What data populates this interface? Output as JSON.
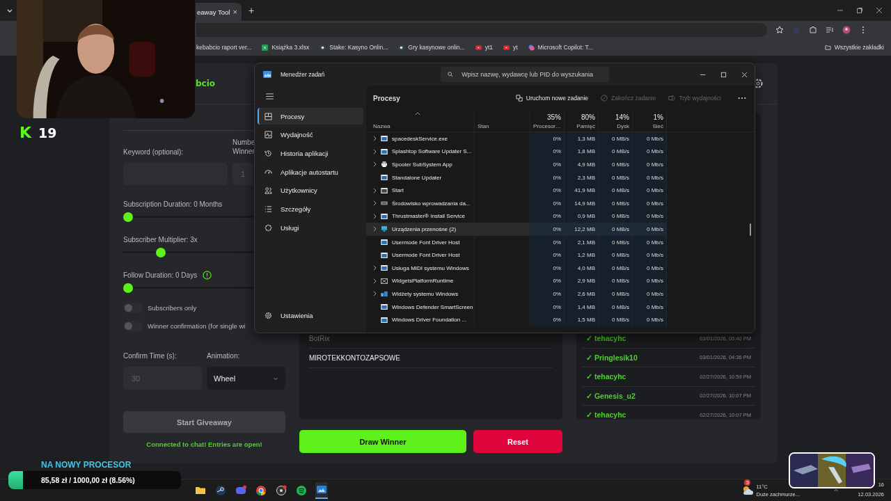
{
  "browser": {
    "tab_title": "eaway Tool",
    "tab_close": "×",
    "new_tab": "+",
    "bookmarks": [
      {
        "label": "kebabcio raport ver...",
        "kind": "none"
      },
      {
        "label": "Książka 3.xlsx",
        "kind": "sheet"
      },
      {
        "label": "Stake: Kasyno Onlin...",
        "kind": "stake"
      },
      {
        "label": "Gry kasynowe onlin...",
        "kind": "stake"
      },
      {
        "label": "yt1",
        "kind": "video"
      },
      {
        "label": "yt",
        "kind": "video"
      },
      {
        "label": "Microsoft Copilot: T...",
        "kind": "copilot"
      }
    ],
    "all_bookmarks": "Wszystkie zakładki"
  },
  "giveaway": {
    "brand": "bcio",
    "keyword_label": "Keyword (optional):",
    "winners_label": "Numbe Winner",
    "winners_placeholder": "1",
    "sliders": [
      {
        "label": "Subscription Duration: 0 Months",
        "level": 0,
        "info": false
      },
      {
        "label": "Subscriber Multiplier: 3x",
        "level": 0.27,
        "info": false
      },
      {
        "label": "Follow Duration:  0  Days",
        "level": 0,
        "info": true
      }
    ],
    "toggles": [
      {
        "label": "Subscribers only",
        "on": false
      },
      {
        "label": "Winner confirmation (for single wi",
        "on": false
      }
    ],
    "confirm_label": "Confirm Time (s):",
    "confirm_placeholder": "30",
    "animation_label": "Animation:",
    "animation_value": "Wheel",
    "start_button": "Start Giveaway",
    "status": "Connected to chat! Entries are open!",
    "entries": [
      {
        "name": "BotRix",
        "muted": true
      },
      {
        "name": "MIROTEKKONTOZAPSOWE",
        "muted": false
      }
    ],
    "winners": [
      {
        "name": "✓ tehacyhc",
        "time": "03/01/2026, 05:40 PM"
      },
      {
        "name": "✓ Pringlesik10",
        "time": "03/01/2026, 04:36 PM"
      },
      {
        "name": "✓ tehacyhc",
        "time": "02/27/2026, 10:59 PM"
      },
      {
        "name": "✓ Genesis_u2",
        "time": "02/27/2026, 10:07 PM"
      },
      {
        "name": "✓ tehacyhc",
        "time": "02/27/2026, 10:07 PM"
      }
    ],
    "draw_button": "Draw Winner",
    "reset_button": "Reset"
  },
  "task_manager": {
    "title": "Menedżer zadań",
    "search_placeholder": "Wpisz nazwę, wydawcę lub PID do wyszukania",
    "nav": [
      {
        "label": "Procesy",
        "kind": "processes",
        "selected": true
      },
      {
        "label": "Wydajność",
        "kind": "performance",
        "selected": false
      },
      {
        "label": "Historia aplikacji",
        "kind": "history",
        "selected": false
      },
      {
        "label": "Aplikacje autostartu",
        "kind": "startup",
        "selected": false
      },
      {
        "label": "Użytkownicy",
        "kind": "users",
        "selected": false
      },
      {
        "label": "Szczegóły",
        "kind": "details",
        "selected": false
      },
      {
        "label": "Usługi",
        "kind": "services",
        "selected": false
      }
    ],
    "settings": "Ustawienia",
    "page_title": "Procesy",
    "actions": [
      {
        "label": "Uruchom nowe zadanie",
        "kind": "run",
        "disabled": false
      },
      {
        "label": "Zakończ zadanie",
        "kind": "end",
        "disabled": true
      },
      {
        "label": "Tryb wydajności",
        "kind": "eco",
        "disabled": true
      }
    ],
    "columns": [
      {
        "kind": "name",
        "label": "Nazwa"
      },
      {
        "kind": "status",
        "label": "Stan"
      },
      {
        "kind": "metric",
        "usage": "35%",
        "label": "Procesor…"
      },
      {
        "kind": "metric",
        "usage": "80%",
        "label": "Pamięć"
      },
      {
        "kind": "metric",
        "usage": "14%",
        "label": "Dysk"
      },
      {
        "kind": "metric",
        "usage": "1%",
        "label": "Sieć"
      }
    ],
    "rows": [
      {
        "name": "spacedeskService.exe",
        "kind": "app",
        "expandable": true,
        "highlighted": false,
        "cpu": "0%",
        "mem": "1,3 MB",
        "disk": "0 MB/s",
        "net": "0 Mb/s"
      },
      {
        "name": "Splashtop Software Updater S...",
        "kind": "app",
        "expandable": true,
        "highlighted": false,
        "cpu": "0%",
        "mem": "1,8 MB",
        "disk": "0 MB/s",
        "net": "0 Mb/s"
      },
      {
        "name": "Spooler SubSystem App",
        "kind": "printer",
        "expandable": true,
        "highlighted": false,
        "cpu": "0%",
        "mem": "4,9 MB",
        "disk": "0 MB/s",
        "net": "0 Mb/s"
      },
      {
        "name": "Standalone Updater",
        "kind": "app",
        "expandable": false,
        "highlighted": false,
        "cpu": "0%",
        "mem": "2,3 MB",
        "disk": "0 MB/s",
        "net": "0 Mb/s"
      },
      {
        "name": "Start",
        "kind": "window",
        "expandable": true,
        "highlighted": false,
        "cpu": "0%",
        "mem": "41,9 MB",
        "disk": "0 MB/s",
        "net": "0 Mb/s"
      },
      {
        "name": "Środowisko wprowadzania da...",
        "kind": "keyboard",
        "expandable": true,
        "highlighted": false,
        "cpu": "0%",
        "mem": "14,9 MB",
        "disk": "0 MB/s",
        "net": "0 Mb/s"
      },
      {
        "name": "Thrustmaster® Install Service",
        "kind": "app",
        "expandable": true,
        "highlighted": false,
        "cpu": "0%",
        "mem": "0,9 MB",
        "disk": "0 MB/s",
        "net": "0 Mb/s"
      },
      {
        "name": "Urządzenia przenośne (2)",
        "kind": "device",
        "expandable": true,
        "highlighted": true,
        "cpu": "0%",
        "mem": "12,2 MB",
        "disk": "0 MB/s",
        "net": "0 Mb/s"
      },
      {
        "name": "Usermode Font Driver Host",
        "kind": "app",
        "expandable": false,
        "highlighted": false,
        "cpu": "0%",
        "mem": "2,1 MB",
        "disk": "0 MB/s",
        "net": "0 Mb/s"
      },
      {
        "name": "Usermode Font Driver Host",
        "kind": "app",
        "expandable": false,
        "highlighted": false,
        "cpu": "0%",
        "mem": "1,2 MB",
        "disk": "0 MB/s",
        "net": "0 Mb/s"
      },
      {
        "name": "Usługa MIDI systemu Windows",
        "kind": "app",
        "expandable": true,
        "highlighted": false,
        "cpu": "0%",
        "mem": "4,0 MB",
        "disk": "0 MB/s",
        "net": "0 Mb/s"
      },
      {
        "name": "WidgetsPlatformRuntime",
        "kind": "crossed",
        "expandable": true,
        "highlighted": false,
        "cpu": "0%",
        "mem": "2,9 MB",
        "disk": "0 MB/s",
        "net": "0 Mb/s"
      },
      {
        "name": "Widżety systemu Windows",
        "kind": "widgets",
        "expandable": true,
        "highlighted": false,
        "cpu": "0%",
        "mem": "2,6 MB",
        "disk": "0 MB/s",
        "net": "0 Mb/s"
      },
      {
        "name": "Windows Defender SmartScreen",
        "kind": "app",
        "expandable": false,
        "highlighted": false,
        "cpu": "0%",
        "mem": "1,4 MB",
        "disk": "0 MB/s",
        "net": "0 Mb/s"
      },
      {
        "name": "Windows Driver Foundation ...",
        "kind": "app",
        "expandable": false,
        "highlighted": false,
        "cpu": "0%",
        "mem": "1,5 MB",
        "disk": "0 MB/s",
        "net": "0 Mb/s"
      }
    ]
  },
  "stream": {
    "logo": "K",
    "viewers": "19",
    "goal_title": "NA NOWY PROCESOR",
    "goal_text": "85,58 zł / 1000,00 zł (8.56%)",
    "level": 0.0856
  },
  "taskbar": {
    "apps": [
      {
        "kind": "folder",
        "active": false
      },
      {
        "kind": "steam",
        "active": false
      },
      {
        "kind": "chat",
        "active": false
      },
      {
        "kind": "chrome",
        "active": false
      },
      {
        "kind": "record",
        "active": false
      },
      {
        "kind": "music",
        "active": false
      },
      {
        "kind": "monitor",
        "active": true
      }
    ],
    "weather_badge": "3",
    "temperature": "11°C",
    "weather": "Duże zachmurze...",
    "time": "16",
    "date": "12.03.2026"
  }
}
